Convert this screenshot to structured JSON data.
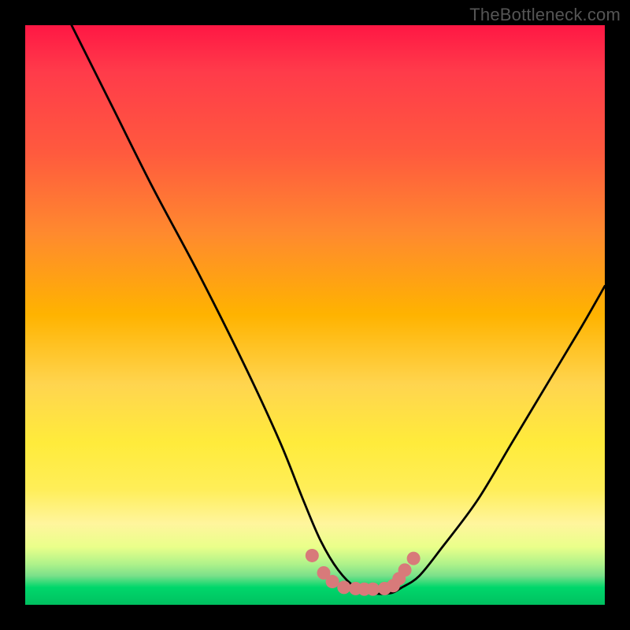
{
  "watermark": "TheBottleneck.com",
  "chart_data": {
    "type": "line",
    "title": "",
    "xlabel": "",
    "ylabel": "",
    "xlim": [
      0,
      100
    ],
    "ylim": [
      0,
      100
    ],
    "series": [
      {
        "name": "curve",
        "x": [
          8,
          15,
          22,
          30,
          38,
          44,
          48,
          51,
          54,
          57,
          60,
          63,
          65,
          68,
          72,
          78,
          84,
          90,
          96,
          100
        ],
        "y": [
          100,
          86,
          72,
          57,
          41,
          28,
          18,
          11,
          6,
          3,
          2,
          2,
          3,
          5,
          10,
          18,
          28,
          38,
          48,
          55
        ]
      }
    ],
    "markers": {
      "name": "trough-points",
      "color": "#d87a7a",
      "x": [
        49.5,
        51.5,
        53,
        55,
        57,
        58.5,
        60,
        62,
        63.5,
        64.5,
        65.5,
        67
      ],
      "y": [
        8.5,
        5.5,
        4,
        3,
        2.8,
        2.7,
        2.7,
        2.8,
        3.3,
        4.5,
        6,
        8
      ]
    }
  }
}
